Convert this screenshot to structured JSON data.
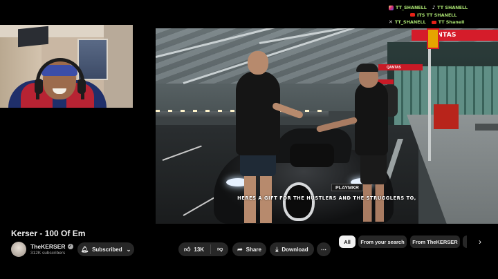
{
  "socials": [
    {
      "icon": "instagram-icon",
      "text": "TT_SHANELL",
      "color": "#a8e070"
    },
    {
      "icon": "tiktok-icon",
      "text": "TT SHANELL",
      "color": "#a8e070"
    },
    {
      "icon": "youtube-icon",
      "text": "ITS TT SHANELL",
      "color": "#a8e070"
    },
    {
      "icon": "x-icon",
      "text": "TT_SHANELL",
      "color": "#a8e070"
    },
    {
      "icon": "youtube-icon",
      "text": "TT Shanell",
      "color": "#a8e070"
    }
  ],
  "video": {
    "brand_sign": "QANTAS",
    "small_sign": "QANTAS",
    "plate": "PLAYMKR",
    "caption": "HERES A GIFT FOR THE HUSTLERS AND THE STRUGGLERS TO,"
  },
  "meta": {
    "title": "Kerser - 100 Of Em",
    "channel": "TheKERSER",
    "subscribers": "312K subscribers",
    "subscribe_label": "Subscribed",
    "likes": "13K",
    "share_label": "Share",
    "download_label": "Download",
    "more_label": "⋯"
  },
  "chips": [
    {
      "label": "All",
      "active": true
    },
    {
      "label": "From your search",
      "active": false
    },
    {
      "label": "From TheKERSER",
      "active": false
    }
  ],
  "colors": {
    "accent_green": "#a8e070",
    "qantas_red": "#d51c2a",
    "youtube_red": "#e62117",
    "pill_bg": "#272727"
  }
}
